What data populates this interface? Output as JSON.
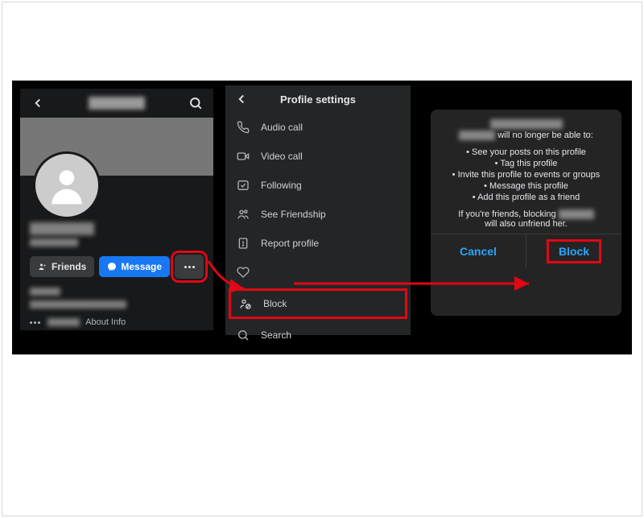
{
  "panel1": {
    "friends_label": "Friends",
    "message_label": "Message",
    "about_label": "About Info"
  },
  "panel2": {
    "title": "Profile settings",
    "items": {
      "audio": "Audio call",
      "video": "Video call",
      "following": "Following",
      "friendship": "See Friendship",
      "report": "Report profile",
      "block": "Block",
      "search": "Search"
    }
  },
  "panel3": {
    "line1_suffix": " will no longer be able to:",
    "bullets": [
      "See your posts on this profile",
      "Tag this profile",
      "Invite this profile to events or groups",
      "Message this profile",
      "Add this profile as a friend"
    ],
    "line2_prefix": "If you're friends, blocking ",
    "line2_suffix": " will also unfriend her.",
    "cancel": "Cancel",
    "block": "Block"
  }
}
